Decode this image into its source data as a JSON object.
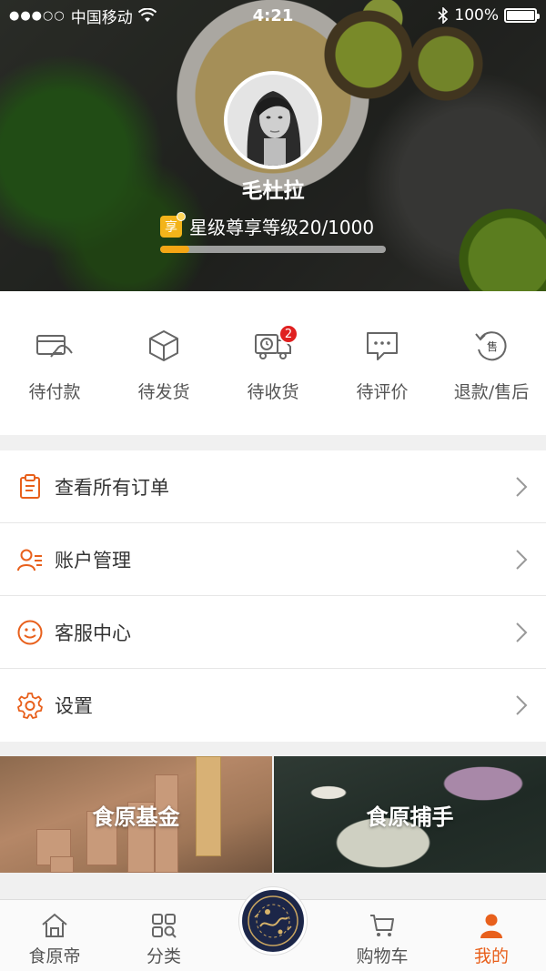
{
  "status_bar": {
    "signal": "●●●○○",
    "carrier": "中国移动",
    "time": "4:21",
    "battery": "100%"
  },
  "profile": {
    "name": "毛杜拉",
    "level_badge": "享",
    "level_text": "星级尊享等级20/1000",
    "level_progress": 0.13
  },
  "orders": [
    {
      "label": "待付款",
      "icon": "card-payment-icon"
    },
    {
      "label": "待发货",
      "icon": "package-box-icon"
    },
    {
      "label": "待收货",
      "icon": "delivery-truck-icon",
      "badge": "2"
    },
    {
      "label": "待评价",
      "icon": "comment-bubble-icon"
    },
    {
      "label": "退款/售后",
      "icon": "after-sale-icon",
      "icon_text": "售"
    }
  ],
  "menu": [
    {
      "label": "查看所有订单",
      "icon": "clipboard-icon"
    },
    {
      "label": "账户管理",
      "icon": "account-user-icon"
    },
    {
      "label": "客服中心",
      "icon": "smiley-service-icon"
    },
    {
      "label": "设置",
      "icon": "gear-icon"
    }
  ],
  "banners": [
    {
      "title": "食原基金"
    },
    {
      "title": "食原捕手"
    }
  ],
  "tabbar": [
    {
      "label": "食原帝",
      "icon": "home-icon"
    },
    {
      "label": "分类",
      "icon": "category-grid-icon"
    },
    {
      "label": "",
      "icon": "center-logo-icon"
    },
    {
      "label": "购物车",
      "icon": "cart-icon"
    },
    {
      "label": "我的",
      "icon": "profile-person-icon",
      "active": true
    }
  ],
  "colors": {
    "accent": "#e8601c",
    "badge_red": "#e02020",
    "level_bar": "#f5a614",
    "icon_orange": "#e8601c",
    "icon_gray": "#666666"
  }
}
